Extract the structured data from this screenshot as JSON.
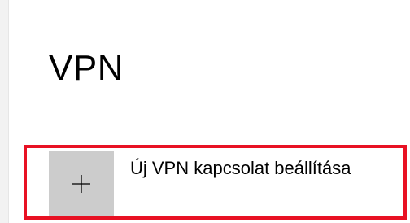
{
  "page": {
    "title": "VPN"
  },
  "add_vpn": {
    "label": "Új VPN kapcsolat beállítása",
    "icon": "plus-icon",
    "tile_color": "#cccccc",
    "highlight_color": "#e81123"
  }
}
